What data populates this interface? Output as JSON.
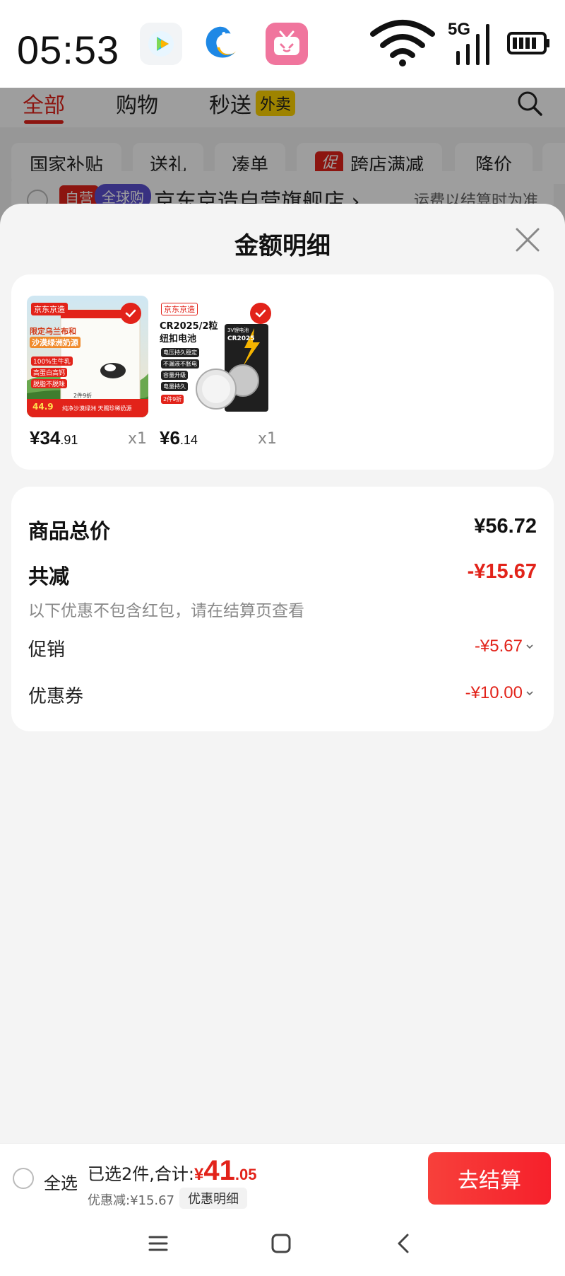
{
  "status_bar": {
    "time": "05:53",
    "icons": [
      "video-app-icon",
      "dolphin-app-icon",
      "tv-app-icon",
      "wifi-icon",
      "5g-signal-icon",
      "battery-icon"
    ],
    "network_label": "5G"
  },
  "cart": {
    "tabs": [
      {
        "label": "全部",
        "active": true
      },
      {
        "label": "购物",
        "active": false
      },
      {
        "label": "秒送",
        "active": false,
        "badge": "外卖"
      }
    ],
    "chips": [
      {
        "label": "国家补贴"
      },
      {
        "label": "送礼"
      },
      {
        "label": "凑单"
      },
      {
        "label": "跨店满减",
        "tag": "促"
      },
      {
        "label": "降价"
      }
    ],
    "store": {
      "tag_self": "自营",
      "tag_global": "全球购",
      "name": "京东京造自营旗舰店 ›",
      "shipping_note": "运费以结算时为准"
    }
  },
  "sheet": {
    "title": "金额明细",
    "products": [
      {
        "price_int": "¥34",
        "price_cents": ".91",
        "qty": "x1",
        "image": {
          "brand": "京东京造",
          "headline": "限定乌兰布和",
          "headline2": "沙漠绿洲奶源",
          "features": [
            "100%生牛乳",
            "高蛋白高钙",
            "脱脂不脱味"
          ],
          "promo": "2件9折",
          "promo_price": "44.9",
          "footer": "纯净沙漠绿洲 天赐珍稀奶源"
        }
      },
      {
        "price_int": "¥6",
        "price_cents": ".14",
        "qty": "x1",
        "image": {
          "brand": "京东京造",
          "headline": "CR2025/2粒",
          "headline2": "纽扣电池",
          "features": [
            "电压持久稳定",
            "不漏液不胀电",
            "容量升级",
            "电量持久"
          ],
          "promo": "2件9折",
          "pack_label": "3V锂电池",
          "pack_model": "CR2025"
        }
      }
    ],
    "breakdown": {
      "total_label": "商品总价",
      "total_value": "¥56.72",
      "reduce_label": "共减",
      "reduce_value": "-¥15.67",
      "note": "以下优惠不包含红包，请在结算页查看",
      "promo_label": "促销",
      "promo_value": "-¥5.67",
      "coupon_label": "优惠券",
      "coupon_value": "-¥10.00"
    }
  },
  "checkout": {
    "select_all": "全选",
    "summary_prefix": "已选2件,合计:",
    "total_symbol": "¥",
    "total_int": "41",
    "total_cents": ".05",
    "discount": "优惠减:¥15.67",
    "detail_button": "优惠明细",
    "checkout_button": "去结算"
  },
  "colors": {
    "accent_red": "#e2231a",
    "button_red": "#f6202b",
    "sheet_bg": "#f4f4f4",
    "overlay": "rgba(0,0,0,0.38)"
  }
}
